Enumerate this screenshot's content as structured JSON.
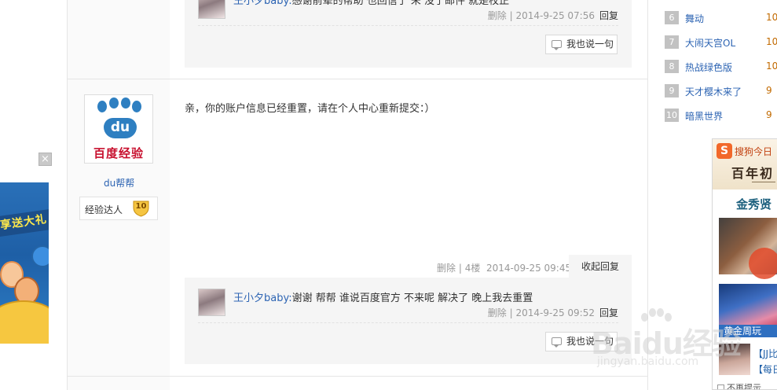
{
  "top_reply": {
    "name": "王小夕baby:",
    "text": "感谢前辈的帮助 也回信了 未 没了邮件 就是校正",
    "delete_label": "删除",
    "time": "2014-9-25 07:56",
    "reply_label": "回复"
  },
  "say_button_label": "我也说一句",
  "post": {
    "user": {
      "logo_text": "du",
      "logo_caption": "百度经验",
      "name": "du帮帮",
      "level_label": "经验达人",
      "level": "10"
    },
    "body": "亲，你的账户信息已经重置，请在个人中心重新提交：）",
    "delete_label": "删除",
    "floor": "4楼",
    "time": "2014-09-25 09:45",
    "collapse_label": "收起回复",
    "reply": {
      "name": "王小夕baby:",
      "text": "谢谢 帮帮 谁说百度官方 不来呢 解决了 晚上我去重置",
      "delete_label": "删除",
      "time": "2014-9-25 09:52",
      "reply_label": "回复"
    }
  },
  "sidebar": {
    "ranking": [
      {
        "num": "6",
        "name": "舞动",
        "count": "10"
      },
      {
        "num": "7",
        "name": "大闹天宫OL",
        "count": "10"
      },
      {
        "num": "8",
        "name": "热战绿色版",
        "count": "10"
      },
      {
        "num": "9",
        "name": "天才樱木来了",
        "count": "9"
      },
      {
        "num": "10",
        "name": "暗黑世界",
        "count": "9"
      }
    ],
    "sogou_ad": {
      "logo": "S",
      "title": "搜狗今日",
      "calligraphy": "百年初",
      "subtitle": "金秀贤",
      "caption": "黄金周玩",
      "link1": "【JJ比",
      "link2": "【每日",
      "remind": "不再提示"
    }
  },
  "left_ad": {
    "promo": "享送大礼",
    "close_icon": "×"
  },
  "watermark": {
    "text": "Baidu经验",
    "url": "jingyan.baidu.com"
  },
  "colors": {
    "link": "#2d64b3",
    "count": "#c26a00",
    "logo_blue": "#2e7fc1",
    "logo_red": "#c8102e"
  }
}
